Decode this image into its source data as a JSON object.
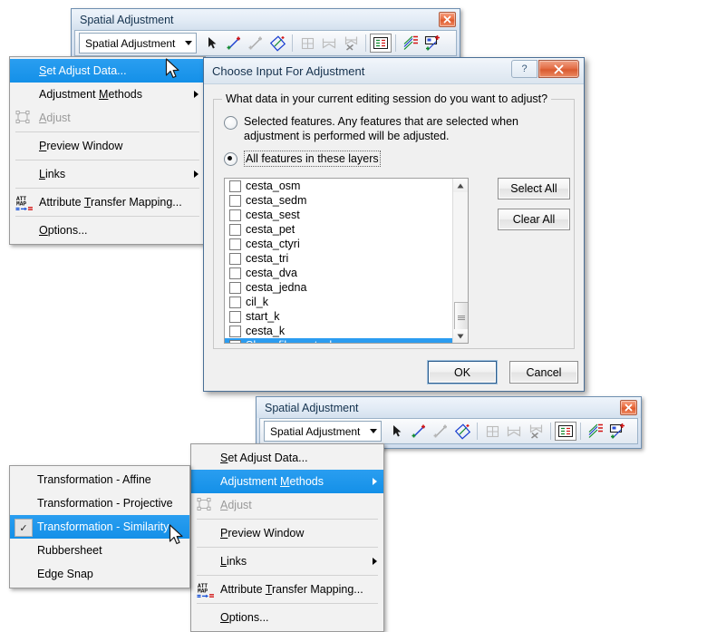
{
  "toolbar_top": {
    "title": "Spatial Adjustment",
    "combo_label": "Spatial Adjustment",
    "close_label": "x",
    "tools": [
      {
        "name": "select-elements-tool",
        "icon": "arrow-cursor-icon"
      },
      {
        "name": "new-displacement-link-tool",
        "icon": "displacement-link-icon"
      },
      {
        "name": "new-identity-link-tool",
        "icon": "identity-link-icon"
      },
      {
        "name": "select-links-tool",
        "icon": "select-links-icon"
      },
      {
        "name": "multiple-displacement-links-tool",
        "icon": "grid-icon"
      },
      {
        "name": "edge-match-tool",
        "icon": "edge-match-icon"
      },
      {
        "name": "edge-snap-tool",
        "icon": "edge-snap-icon"
      },
      {
        "name": "view-link-table-tool",
        "icon": "link-table-icon"
      },
      {
        "name": "attribute-transfer-tool",
        "icon": "attribute-transfer-icon"
      },
      {
        "name": "new-connection-tool",
        "icon": "new-connection-icon"
      }
    ]
  },
  "toolbar_bottom": {
    "title": "Spatial Adjustment",
    "combo_label": "Spatial Adjustment",
    "close_label": "x"
  },
  "menu_top": {
    "items": [
      {
        "label": "Set Adjust Data...",
        "accel": "S",
        "selected": true,
        "disabled": false,
        "submenu": false,
        "icon": null
      },
      {
        "label": "Adjustment Methods",
        "accel": "M",
        "selected": false,
        "disabled": false,
        "submenu": true,
        "icon": null
      },
      {
        "label": "Adjust",
        "accel": "A",
        "selected": false,
        "disabled": true,
        "submenu": false,
        "icon": "adjust-icon"
      },
      {
        "label": "Preview Window",
        "accel": "P",
        "selected": false,
        "disabled": false,
        "submenu": false,
        "icon": null
      },
      {
        "label": "Links",
        "accel": "L",
        "selected": false,
        "disabled": false,
        "submenu": true,
        "icon": null
      },
      {
        "label": "Attribute Transfer Mapping...",
        "accel": "T",
        "selected": false,
        "disabled": false,
        "submenu": false,
        "icon": "att-map-icon"
      },
      {
        "label": "Options...",
        "accel": "O",
        "selected": false,
        "disabled": false,
        "submenu": false,
        "icon": null
      }
    ]
  },
  "menu_bottom": {
    "items": [
      {
        "label": "Set Adjust Data...",
        "accel": "S",
        "selected": false,
        "disabled": false,
        "submenu": false,
        "icon": null
      },
      {
        "label": "Adjustment Methods",
        "accel": "M",
        "selected": true,
        "disabled": false,
        "submenu": true,
        "icon": null
      },
      {
        "label": "Adjust",
        "accel": "A",
        "selected": false,
        "disabled": true,
        "submenu": false,
        "icon": "adjust-icon"
      },
      {
        "label": "Preview Window",
        "accel": "P",
        "selected": false,
        "disabled": false,
        "submenu": false,
        "icon": null
      },
      {
        "label": "Links",
        "accel": "L",
        "selected": false,
        "disabled": false,
        "submenu": true,
        "icon": null
      },
      {
        "label": "Attribute Transfer Mapping...",
        "accel": "T",
        "selected": false,
        "disabled": false,
        "submenu": false,
        "icon": "att-map-icon"
      },
      {
        "label": "Options...",
        "accel": "O",
        "selected": false,
        "disabled": false,
        "submenu": false,
        "icon": null
      }
    ]
  },
  "submenu_methods": {
    "items": [
      {
        "label": "Transformation - Affine",
        "checked": false,
        "selected": false
      },
      {
        "label": "Transformation - Projective",
        "checked": false,
        "selected": false
      },
      {
        "label": "Transformation - Similarity",
        "checked": true,
        "selected": true
      },
      {
        "label": "Rubbersheet",
        "checked": false,
        "selected": false
      },
      {
        "label": "Edge Snap",
        "checked": false,
        "selected": false
      }
    ],
    "check_glyph": "✓"
  },
  "dialog": {
    "title": "Choose Input For Adjustment",
    "help_label": "?",
    "close_label": "✕",
    "group_caption": "What data in your current editing session do you want to adjust?",
    "radio_selected_features": {
      "label_line1": "Selected features.  Any features that are selected when",
      "label_line2": "adjustment is performed will be adjusted.",
      "checked": false
    },
    "radio_all_features": {
      "label": "All features in these layers",
      "checked": true
    },
    "layers": [
      {
        "name": "cesta_osm",
        "checked": false,
        "selected": false
      },
      {
        "name": "cesta_sedm",
        "checked": false,
        "selected": false
      },
      {
        "name": "cesta_sest",
        "checked": false,
        "selected": false
      },
      {
        "name": "cesta_pet",
        "checked": false,
        "selected": false
      },
      {
        "name": "cesta_ctyri",
        "checked": false,
        "selected": false
      },
      {
        "name": "cesta_tri",
        "checked": false,
        "selected": false
      },
      {
        "name": "cesta_dva",
        "checked": false,
        "selected": false
      },
      {
        "name": "cesta_jedna",
        "checked": false,
        "selected": false
      },
      {
        "name": "cil_k",
        "checked": false,
        "selected": false
      },
      {
        "name": "start_k",
        "checked": false,
        "selected": false
      },
      {
        "name": "cesta_k",
        "checked": false,
        "selected": false
      },
      {
        "name": "Shapefile_vrstevky",
        "checked": true,
        "selected": true
      }
    ],
    "check_glyph": "✔",
    "select_all_label": "Select All",
    "clear_all_label": "Clear All",
    "ok_label": "OK",
    "cancel_label": "Cancel"
  },
  "colors": {
    "menu_highlight": "#1490e8",
    "list_selection": "#2b9cf0",
    "close_red": "#d95b30",
    "title_text": "#15314d"
  }
}
